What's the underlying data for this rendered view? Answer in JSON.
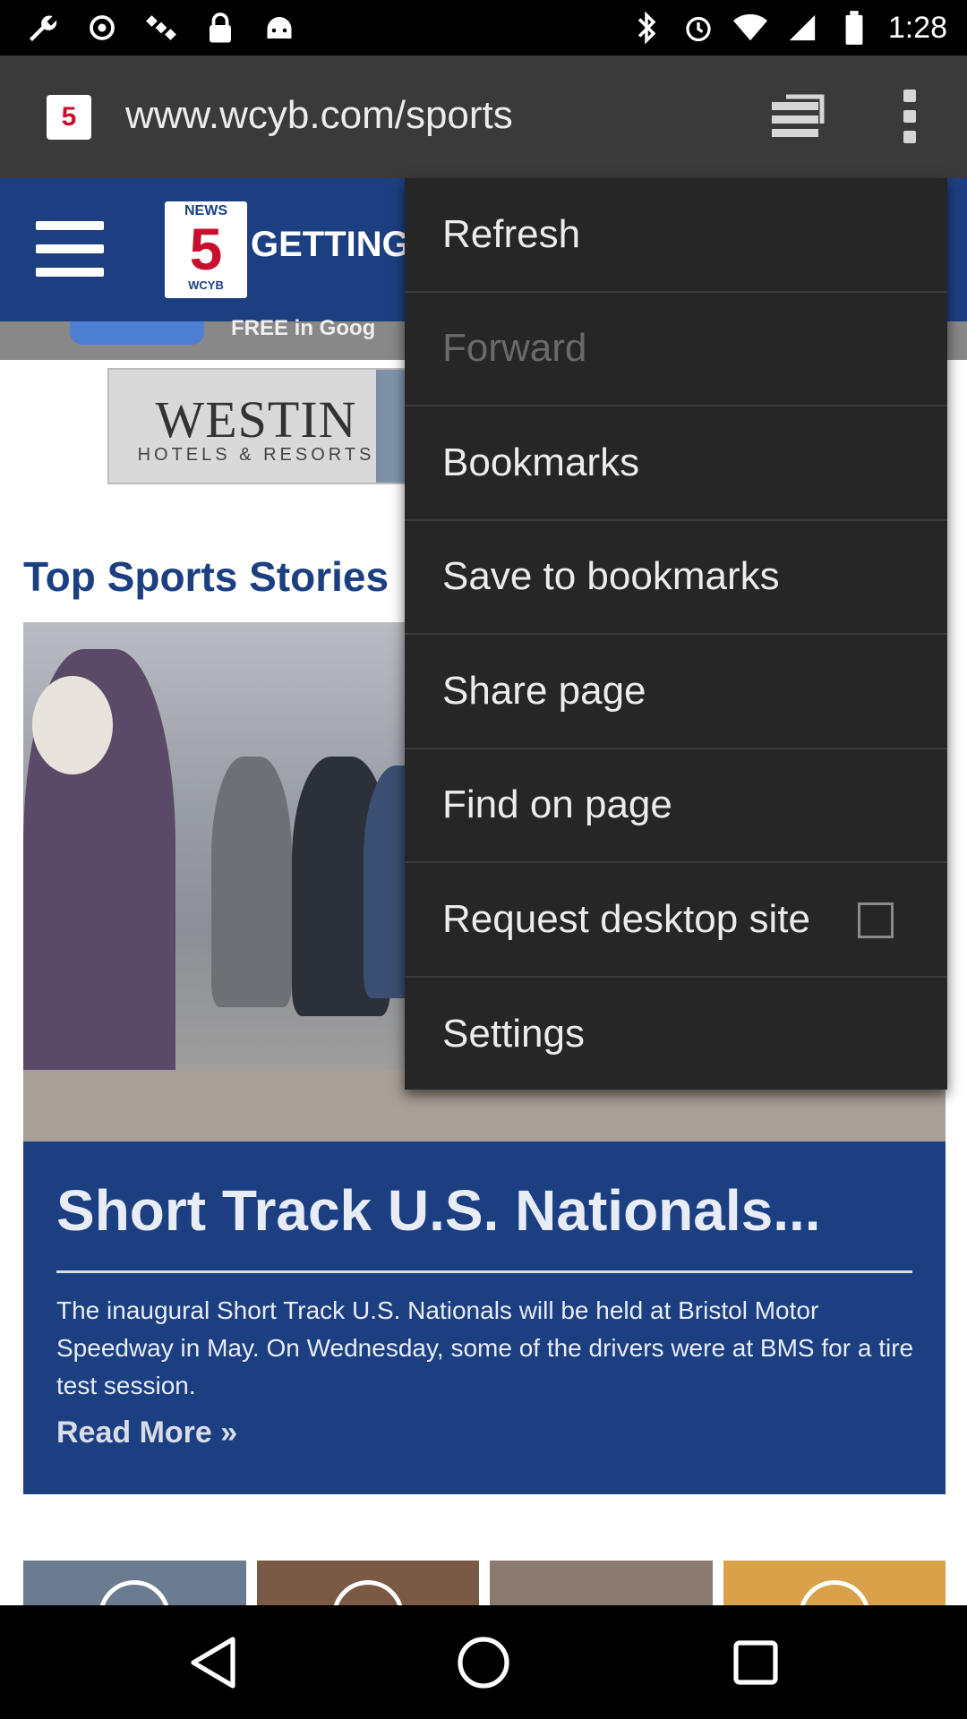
{
  "status_bar": {
    "time": "1:28",
    "left_icons": [
      "wrench-icon",
      "fake-gps-icon",
      "satellite-icon",
      "lock-icon",
      "android-icon"
    ],
    "right_icons": [
      "bluetooth-icon",
      "alarm-icon",
      "wifi-icon",
      "signal-icon",
      "battery-icon"
    ]
  },
  "browser": {
    "favicon_text": "5",
    "url": "www.wcyb.com/sports",
    "tabs_icon": "tab-switcher-icon",
    "menu_icon": "overflow-menu-icon"
  },
  "site": {
    "logo_top": "NEWS",
    "logo_num": "5",
    "logo_bottom": "WCYB",
    "header_text": "GETTING",
    "subnav_text": "FREE   in Goog"
  },
  "ad": {
    "brand": "WESTIN",
    "tagline": "HOTELS & RESORTS"
  },
  "section_title": "Top Sports Stories",
  "story": {
    "title": "Short Track U.S. Nationals...",
    "body": "The inaugural Short Track U.S. Nationals will be held at Bristol Motor Speedway in May. On Wednesday, some of the drivers were at BMS for a tire test session.",
    "read_more": "Read More »"
  },
  "menu": {
    "items": [
      {
        "label": "Refresh",
        "enabled": true
      },
      {
        "label": "Forward",
        "enabled": false
      },
      {
        "label": "Bookmarks",
        "enabled": true
      },
      {
        "label": "Save to bookmarks",
        "enabled": true
      },
      {
        "label": "Share page",
        "enabled": true
      },
      {
        "label": "Find on page",
        "enabled": true
      },
      {
        "label": "Request desktop site",
        "enabled": true,
        "checked": false
      },
      {
        "label": "Settings",
        "enabled": true
      }
    ]
  },
  "nav_bar": {
    "buttons": [
      "back-icon",
      "home-icon",
      "recents-icon"
    ]
  },
  "colors": {
    "site_blue": "#1c3f82",
    "menu_bg": "#262626",
    "urlbar_bg": "#3a3a3a",
    "logo_red": "#c8102e"
  }
}
